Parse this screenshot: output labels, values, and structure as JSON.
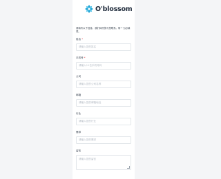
{
  "brand": {
    "name": "O'blossom",
    "logo_icon": "blossom-logo-icon",
    "logo_color": "#1ea5d6",
    "text_color": "#1e2a3a"
  },
  "form": {
    "intro": "请填写以下信息，我们将尽快与您联系。带 * 为必填项。",
    "fields": [
      {
        "label": "姓名",
        "required": true,
        "placeholder": "请输入您的姓名",
        "value": ""
      },
      {
        "label": "手机号",
        "required": true,
        "placeholder": "请输入11位手机号码",
        "value": ""
      },
      {
        "label": "公司",
        "required": false,
        "placeholder": "请输入您的公司名称",
        "value": ""
      },
      {
        "label": "邮箱",
        "required": false,
        "placeholder": "请输入您的邮箱地址",
        "value": ""
      },
      {
        "label": "行业",
        "required": false,
        "placeholder": "请输入您的行业",
        "value": ""
      },
      {
        "label": "需求",
        "required": false,
        "placeholder": "请输入您的需求",
        "value": ""
      },
      {
        "label": "留言",
        "required": false,
        "placeholder": "请输入您的留言",
        "value": ""
      }
    ],
    "required_mark": "*"
  },
  "colors": {
    "page_background": "#f4f5f7",
    "card_background": "#ffffff",
    "input_border": "#e2e6ea",
    "placeholder": "#b3bac3",
    "required": "#e5484d"
  }
}
